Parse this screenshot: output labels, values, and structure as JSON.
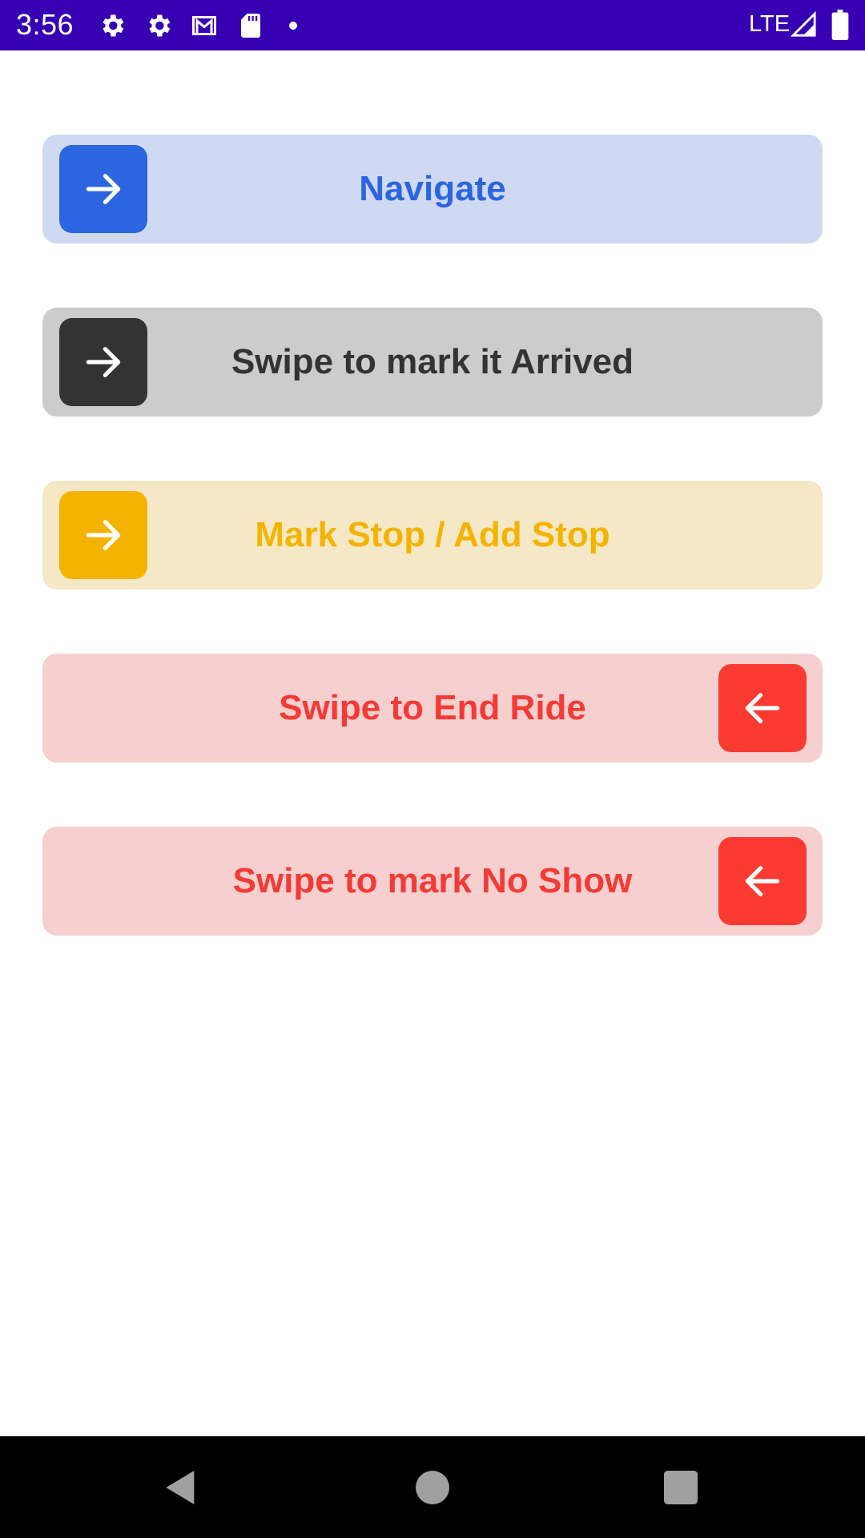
{
  "status_bar": {
    "time": "3:56",
    "network": "LTE",
    "background": "#3700b3",
    "icons": [
      "settings-icon",
      "settings-icon",
      "gmail-icon",
      "sd-card-icon",
      "notification-dot-icon",
      "signal-icon",
      "battery-icon"
    ]
  },
  "sliders": [
    {
      "label": "Navigate",
      "direction": "right",
      "icon": "arrow-right-icon",
      "track_color": "#cfd9f2",
      "knob_color": "#2b65e0",
      "text_color": "#2b65e0"
    },
    {
      "label": "Swipe to mark it Arrived",
      "direction": "right",
      "icon": "arrow-right-icon",
      "track_color": "#cccccc",
      "knob_color": "#333333",
      "text_color": "#333333"
    },
    {
      "label": "Mark Stop / Add Stop",
      "direction": "right",
      "icon": "arrow-right-icon",
      "track_color": "#f4e8c6",
      "knob_color": "#f5b301",
      "text_color": "#f5b301"
    },
    {
      "label": "Swipe to End Ride",
      "direction": "left",
      "icon": "arrow-left-icon",
      "track_color": "#f6cfcf",
      "knob_color": "#fb3a32",
      "text_color": "#f43a36"
    },
    {
      "label": "Swipe to mark No Show",
      "direction": "left",
      "icon": "arrow-left-icon",
      "track_color": "#f6cfcf",
      "knob_color": "#fb3a32",
      "text_color": "#f43a36"
    }
  ],
  "nav_bar": {
    "buttons": [
      "back-icon",
      "home-icon",
      "recents-icon"
    ],
    "background": "#000000"
  }
}
